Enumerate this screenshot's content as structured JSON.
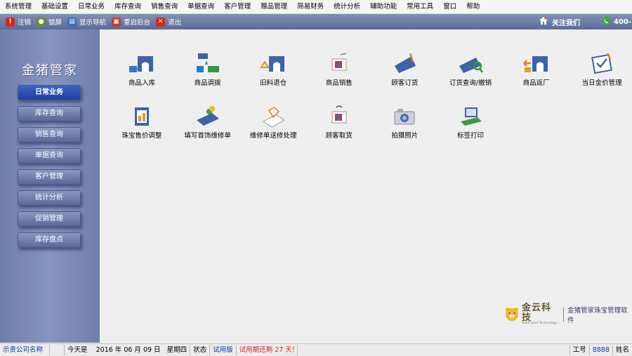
{
  "menu": [
    "系统管理",
    "基础设置",
    "日常业务",
    "库存查询",
    "销售查询",
    "单据查询",
    "客户管理",
    "赠品管理",
    "简易财务",
    "统计分析",
    "辅助功能",
    "常用工具",
    "窗口",
    "帮助"
  ],
  "toolbar": {
    "items": [
      {
        "label": "注销",
        "color": "#d8281e",
        "glyph": "!"
      },
      {
        "label": "锁屏",
        "color": "#6e8f2a",
        "glyph": "●"
      },
      {
        "label": "显示导航",
        "color": "#3a6fbf",
        "glyph": "▤"
      },
      {
        "label": "重启后台",
        "color": "#c0392b",
        "glyph": "▣"
      },
      {
        "label": "退出",
        "color": "#d8281e",
        "glyph": "✕"
      }
    ],
    "follow_label": "关注我们",
    "phone_label": "400-"
  },
  "sidebar": {
    "brand": "金猪管家",
    "items": [
      "日常业务",
      "库存查询",
      "销售查询",
      "单据查询",
      "客户管理",
      "统计分析",
      "促销管理",
      "库存盘点"
    ],
    "active_index": 0
  },
  "tiles": [
    {
      "label": "商品入库",
      "icon": "building-in-icon"
    },
    {
      "label": "商品调拨",
      "icon": "transfer-icon"
    },
    {
      "label": "旧料退仓",
      "icon": "recycle-icon"
    },
    {
      "label": "商品销售",
      "icon": "sale-icon"
    },
    {
      "label": "顾客订货",
      "icon": "order-icon"
    },
    {
      "label": "订货查询/撤销",
      "icon": "order-search-icon"
    },
    {
      "label": "商品返厂",
      "icon": "return-factory-icon"
    },
    {
      "label": "当日金价管理",
      "icon": "gold-price-icon"
    },
    {
      "label": "珠宝售价调整",
      "icon": "price-adjust-icon"
    },
    {
      "label": "填写首饰维修单",
      "icon": "repair-form-icon"
    },
    {
      "label": "维修单送修处理",
      "icon": "repair-process-icon"
    },
    {
      "label": "顾客取货",
      "icon": "pickup-icon"
    },
    {
      "label": "拍摄照片",
      "icon": "camera-icon"
    },
    {
      "label": "标签打印",
      "icon": "label-print-icon"
    }
  ],
  "logo": {
    "company": "金云科技",
    "company_en": "GoldCloud Technology",
    "product": "金猪管家珠宝管理软件"
  },
  "status": {
    "company_name": "示贵公司名称",
    "today_label": "今天是",
    "date": "2016 年 06 月 09 日",
    "weekday": "星期四",
    "state_label": "状态",
    "state_value": "试用版",
    "trial_text": "试用期还剩 27 天！",
    "work_label": "工号",
    "work_no": "8888",
    "name_label": "姓名"
  }
}
